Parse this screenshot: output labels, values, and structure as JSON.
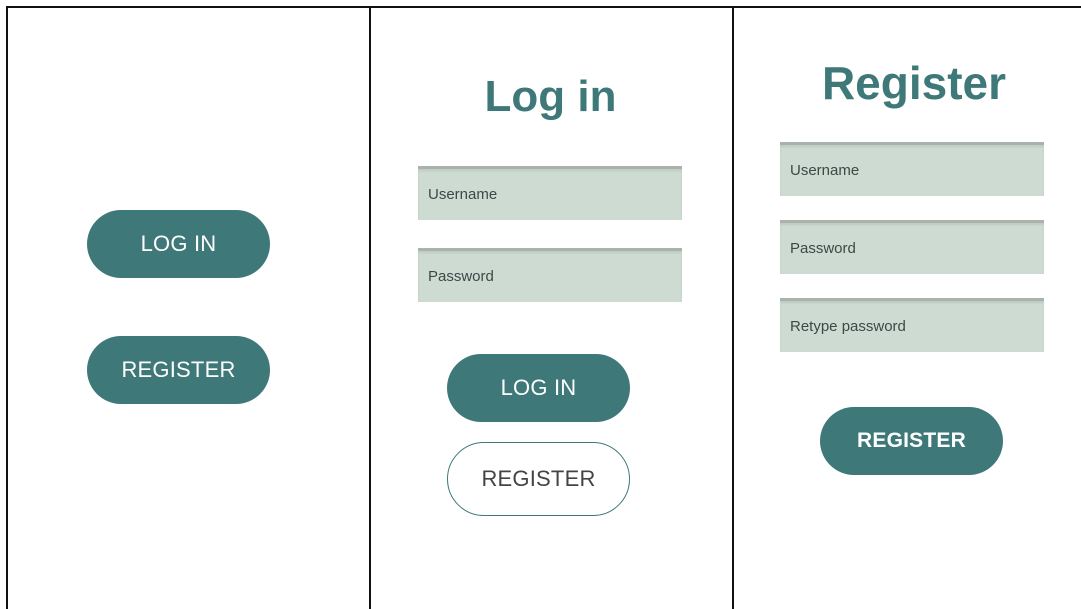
{
  "screen1": {
    "login_label": "LOG IN",
    "register_label": "REGISTER"
  },
  "screen2": {
    "title": "Log in",
    "username_placeholder": "Username",
    "password_placeholder": "Password",
    "login_label": "LOG IN",
    "register_label": "REGISTER"
  },
  "screen3": {
    "title": "Register",
    "username_placeholder": "Username",
    "password_placeholder": "Password",
    "retype_placeholder": "Retype password",
    "register_label": "REGISTER"
  },
  "colors": {
    "accent": "#3e7878",
    "field_bg": "#cddbd2",
    "border": "#111111"
  }
}
